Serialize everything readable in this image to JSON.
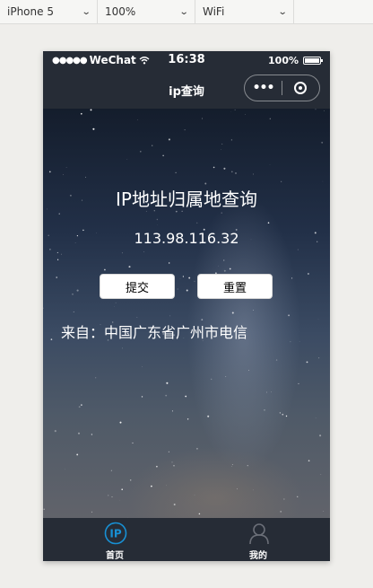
{
  "toolbar": {
    "device": "iPhone 5",
    "zoom": "100%",
    "network": "WiFi"
  },
  "statusbar": {
    "signal": "●●●●●",
    "carrier": "WeChat",
    "time": "16:38",
    "battery": "100%"
  },
  "navbar": {
    "title": "ip查询",
    "more_icon": "•••"
  },
  "main": {
    "heading": "IP地址归属地查询",
    "ip": "113.98.116.32",
    "submit_label": "提交",
    "reset_label": "重置",
    "result": "来自：中国广东省广州市电信"
  },
  "tabbar": {
    "tabs": [
      {
        "label": "首页",
        "icon": "ip-icon",
        "active": true,
        "color": "#1890d4"
      },
      {
        "label": "我的",
        "icon": "user-icon",
        "active": false,
        "color": "#6b6f78"
      }
    ]
  }
}
